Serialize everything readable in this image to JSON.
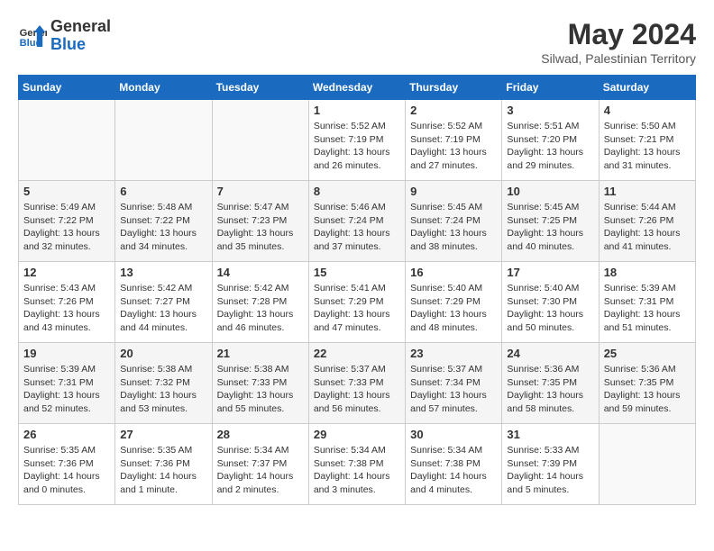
{
  "header": {
    "logo_line1": "General",
    "logo_line2": "Blue",
    "month_year": "May 2024",
    "location": "Silwad, Palestinian Territory"
  },
  "days_of_week": [
    "Sunday",
    "Monday",
    "Tuesday",
    "Wednesday",
    "Thursday",
    "Friday",
    "Saturday"
  ],
  "weeks": [
    [
      {
        "day": "",
        "info": ""
      },
      {
        "day": "",
        "info": ""
      },
      {
        "day": "",
        "info": ""
      },
      {
        "day": "1",
        "info": "Sunrise: 5:52 AM\nSunset: 7:19 PM\nDaylight: 13 hours\nand 26 minutes."
      },
      {
        "day": "2",
        "info": "Sunrise: 5:52 AM\nSunset: 7:19 PM\nDaylight: 13 hours\nand 27 minutes."
      },
      {
        "day": "3",
        "info": "Sunrise: 5:51 AM\nSunset: 7:20 PM\nDaylight: 13 hours\nand 29 minutes."
      },
      {
        "day": "4",
        "info": "Sunrise: 5:50 AM\nSunset: 7:21 PM\nDaylight: 13 hours\nand 31 minutes."
      }
    ],
    [
      {
        "day": "5",
        "info": "Sunrise: 5:49 AM\nSunset: 7:22 PM\nDaylight: 13 hours\nand 32 minutes."
      },
      {
        "day": "6",
        "info": "Sunrise: 5:48 AM\nSunset: 7:22 PM\nDaylight: 13 hours\nand 34 minutes."
      },
      {
        "day": "7",
        "info": "Sunrise: 5:47 AM\nSunset: 7:23 PM\nDaylight: 13 hours\nand 35 minutes."
      },
      {
        "day": "8",
        "info": "Sunrise: 5:46 AM\nSunset: 7:24 PM\nDaylight: 13 hours\nand 37 minutes."
      },
      {
        "day": "9",
        "info": "Sunrise: 5:45 AM\nSunset: 7:24 PM\nDaylight: 13 hours\nand 38 minutes."
      },
      {
        "day": "10",
        "info": "Sunrise: 5:45 AM\nSunset: 7:25 PM\nDaylight: 13 hours\nand 40 minutes."
      },
      {
        "day": "11",
        "info": "Sunrise: 5:44 AM\nSunset: 7:26 PM\nDaylight: 13 hours\nand 41 minutes."
      }
    ],
    [
      {
        "day": "12",
        "info": "Sunrise: 5:43 AM\nSunset: 7:26 PM\nDaylight: 13 hours\nand 43 minutes."
      },
      {
        "day": "13",
        "info": "Sunrise: 5:42 AM\nSunset: 7:27 PM\nDaylight: 13 hours\nand 44 minutes."
      },
      {
        "day": "14",
        "info": "Sunrise: 5:42 AM\nSunset: 7:28 PM\nDaylight: 13 hours\nand 46 minutes."
      },
      {
        "day": "15",
        "info": "Sunrise: 5:41 AM\nSunset: 7:29 PM\nDaylight: 13 hours\nand 47 minutes."
      },
      {
        "day": "16",
        "info": "Sunrise: 5:40 AM\nSunset: 7:29 PM\nDaylight: 13 hours\nand 48 minutes."
      },
      {
        "day": "17",
        "info": "Sunrise: 5:40 AM\nSunset: 7:30 PM\nDaylight: 13 hours\nand 50 minutes."
      },
      {
        "day": "18",
        "info": "Sunrise: 5:39 AM\nSunset: 7:31 PM\nDaylight: 13 hours\nand 51 minutes."
      }
    ],
    [
      {
        "day": "19",
        "info": "Sunrise: 5:39 AM\nSunset: 7:31 PM\nDaylight: 13 hours\nand 52 minutes."
      },
      {
        "day": "20",
        "info": "Sunrise: 5:38 AM\nSunset: 7:32 PM\nDaylight: 13 hours\nand 53 minutes."
      },
      {
        "day": "21",
        "info": "Sunrise: 5:38 AM\nSunset: 7:33 PM\nDaylight: 13 hours\nand 55 minutes."
      },
      {
        "day": "22",
        "info": "Sunrise: 5:37 AM\nSunset: 7:33 PM\nDaylight: 13 hours\nand 56 minutes."
      },
      {
        "day": "23",
        "info": "Sunrise: 5:37 AM\nSunset: 7:34 PM\nDaylight: 13 hours\nand 57 minutes."
      },
      {
        "day": "24",
        "info": "Sunrise: 5:36 AM\nSunset: 7:35 PM\nDaylight: 13 hours\nand 58 minutes."
      },
      {
        "day": "25",
        "info": "Sunrise: 5:36 AM\nSunset: 7:35 PM\nDaylight: 13 hours\nand 59 minutes."
      }
    ],
    [
      {
        "day": "26",
        "info": "Sunrise: 5:35 AM\nSunset: 7:36 PM\nDaylight: 14 hours\nand 0 minutes."
      },
      {
        "day": "27",
        "info": "Sunrise: 5:35 AM\nSunset: 7:36 PM\nDaylight: 14 hours\nand 1 minute."
      },
      {
        "day": "28",
        "info": "Sunrise: 5:34 AM\nSunset: 7:37 PM\nDaylight: 14 hours\nand 2 minutes."
      },
      {
        "day": "29",
        "info": "Sunrise: 5:34 AM\nSunset: 7:38 PM\nDaylight: 14 hours\nand 3 minutes."
      },
      {
        "day": "30",
        "info": "Sunrise: 5:34 AM\nSunset: 7:38 PM\nDaylight: 14 hours\nand 4 minutes."
      },
      {
        "day": "31",
        "info": "Sunrise: 5:33 AM\nSunset: 7:39 PM\nDaylight: 14 hours\nand 5 minutes."
      },
      {
        "day": "",
        "info": ""
      }
    ]
  ]
}
